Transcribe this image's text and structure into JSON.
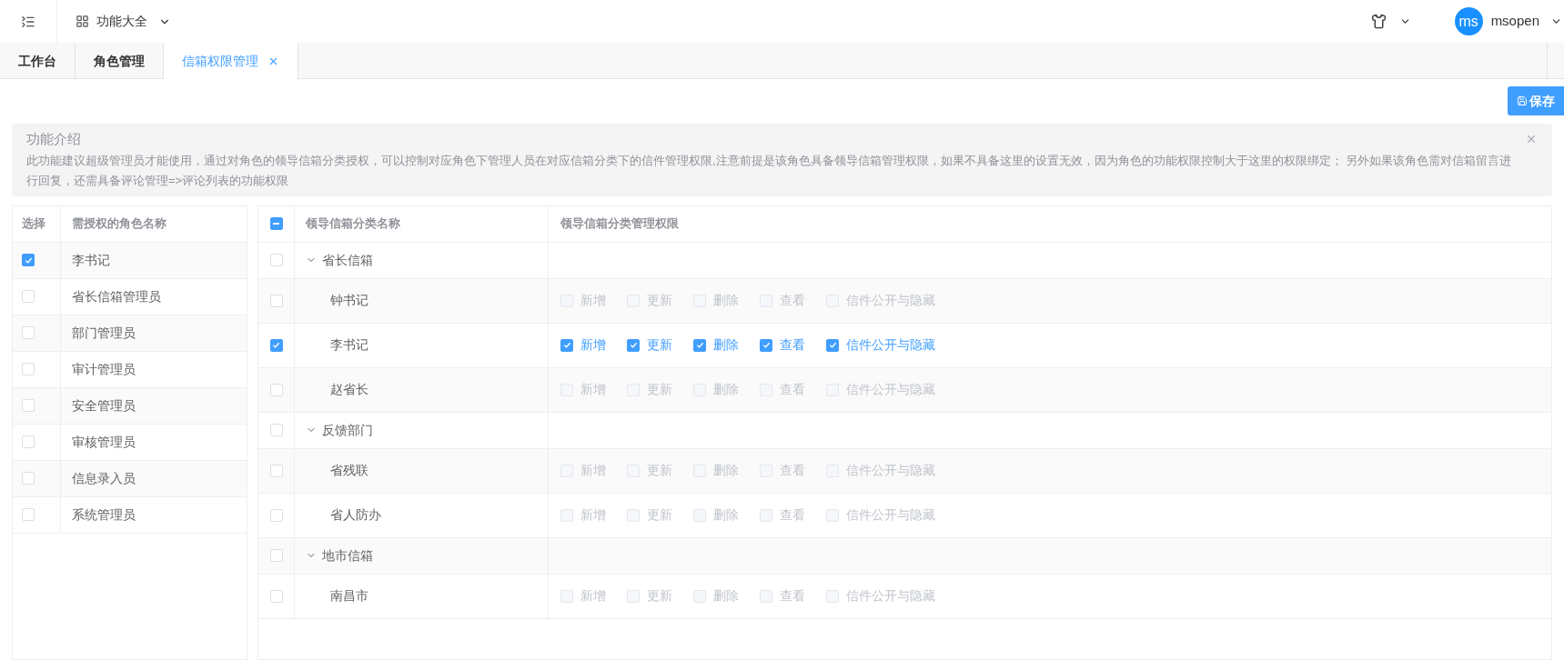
{
  "header": {
    "menu_title": "功能大全",
    "user": {
      "avatar": "ms",
      "name": "msopen"
    }
  },
  "tabs": [
    {
      "label": "工作台",
      "selected": false,
      "closable": false
    },
    {
      "label": "角色管理",
      "selected": false,
      "closable": false
    },
    {
      "label": "信箱权限管理",
      "selected": true,
      "closable": true
    }
  ],
  "toolbar": {
    "save_button": "保存"
  },
  "notice": {
    "title": "功能介绍",
    "text": "此功能建议超级管理员才能使用，通过对角色的领导信箱分类授权，可以控制对应角色下管理人员在对应信箱分类下的信件管理权限,注意前提是该角色具备领导信箱管理权限，如果不具备这里的设置无效，因为角色的功能权限控制大于这里的权限绑定； 另外如果该角色需对信箱留言进行回复，还需具备评论管理=>评论列表的功能权限"
  },
  "roles_table": {
    "columns": [
      "选择",
      "需授权的角色名称"
    ],
    "rows": [
      {
        "name": "李书记",
        "checked": true
      },
      {
        "name": "省长信箱管理员",
        "checked": false
      },
      {
        "name": "部门管理员",
        "checked": false
      },
      {
        "name": "审计管理员",
        "checked": false
      },
      {
        "name": "安全管理员",
        "checked": false
      },
      {
        "name": "审核管理员",
        "checked": false
      },
      {
        "name": "信息录入员",
        "checked": false
      },
      {
        "name": "系统管理员",
        "checked": false
      }
    ]
  },
  "mailbox_table": {
    "header_indeterminate": true,
    "columns": [
      "领导信箱分类名称",
      "领导信箱分类管理权限"
    ],
    "groups": [
      {
        "name": "省长信箱",
        "checked": false,
        "expanded": true,
        "children": [
          {
            "name": "钟书记",
            "checked": false,
            "permissions": [
              {
                "label": "新增",
                "checked": false,
                "disabled": true
              },
              {
                "label": "更新",
                "checked": false,
                "disabled": true
              },
              {
                "label": "删除",
                "checked": false,
                "disabled": true
              },
              {
                "label": "查看",
                "checked": false,
                "disabled": true
              },
              {
                "label": "信件公开与隐藏",
                "checked": false,
                "disabled": true
              }
            ]
          },
          {
            "name": "李书记",
            "checked": true,
            "permissions": [
              {
                "label": "新增",
                "checked": true,
                "disabled": false
              },
              {
                "label": "更新",
                "checked": true,
                "disabled": false
              },
              {
                "label": "删除",
                "checked": true,
                "disabled": false
              },
              {
                "label": "查看",
                "checked": true,
                "disabled": false
              },
              {
                "label": "信件公开与隐藏",
                "checked": true,
                "disabled": false
              }
            ]
          },
          {
            "name": "赵省长",
            "checked": false,
            "permissions": [
              {
                "label": "新增",
                "checked": false,
                "disabled": true
              },
              {
                "label": "更新",
                "checked": false,
                "disabled": true
              },
              {
                "label": "删除",
                "checked": false,
                "disabled": true
              },
              {
                "label": "查看",
                "checked": false,
                "disabled": true
              },
              {
                "label": "信件公开与隐藏",
                "checked": false,
                "disabled": true
              }
            ]
          }
        ]
      },
      {
        "name": "反馈部门",
        "checked": false,
        "expanded": true,
        "children": [
          {
            "name": "省残联",
            "checked": false,
            "permissions": [
              {
                "label": "新增",
                "checked": false,
                "disabled": true
              },
              {
                "label": "更新",
                "checked": false,
                "disabled": true
              },
              {
                "label": "删除",
                "checked": false,
                "disabled": true
              },
              {
                "label": "查看",
                "checked": false,
                "disabled": true
              },
              {
                "label": "信件公开与隐藏",
                "checked": false,
                "disabled": true
              }
            ]
          },
          {
            "name": "省人防办",
            "checked": false,
            "permissions": [
              {
                "label": "新增",
                "checked": false,
                "disabled": true
              },
              {
                "label": "更新",
                "checked": false,
                "disabled": true
              },
              {
                "label": "删除",
                "checked": false,
                "disabled": true
              },
              {
                "label": "查看",
                "checked": false,
                "disabled": true
              },
              {
                "label": "信件公开与隐藏",
                "checked": false,
                "disabled": true
              }
            ]
          }
        ]
      },
      {
        "name": "地市信箱",
        "checked": false,
        "expanded": true,
        "children": [
          {
            "name": "南昌市",
            "checked": false,
            "permissions": [
              {
                "label": "新增",
                "checked": false,
                "disabled": true
              },
              {
                "label": "更新",
                "checked": false,
                "disabled": true
              },
              {
                "label": "删除",
                "checked": false,
                "disabled": true
              },
              {
                "label": "查看",
                "checked": false,
                "disabled": true
              },
              {
                "label": "信件公开与隐藏",
                "checked": false,
                "disabled": true
              }
            ]
          }
        ]
      }
    ]
  }
}
